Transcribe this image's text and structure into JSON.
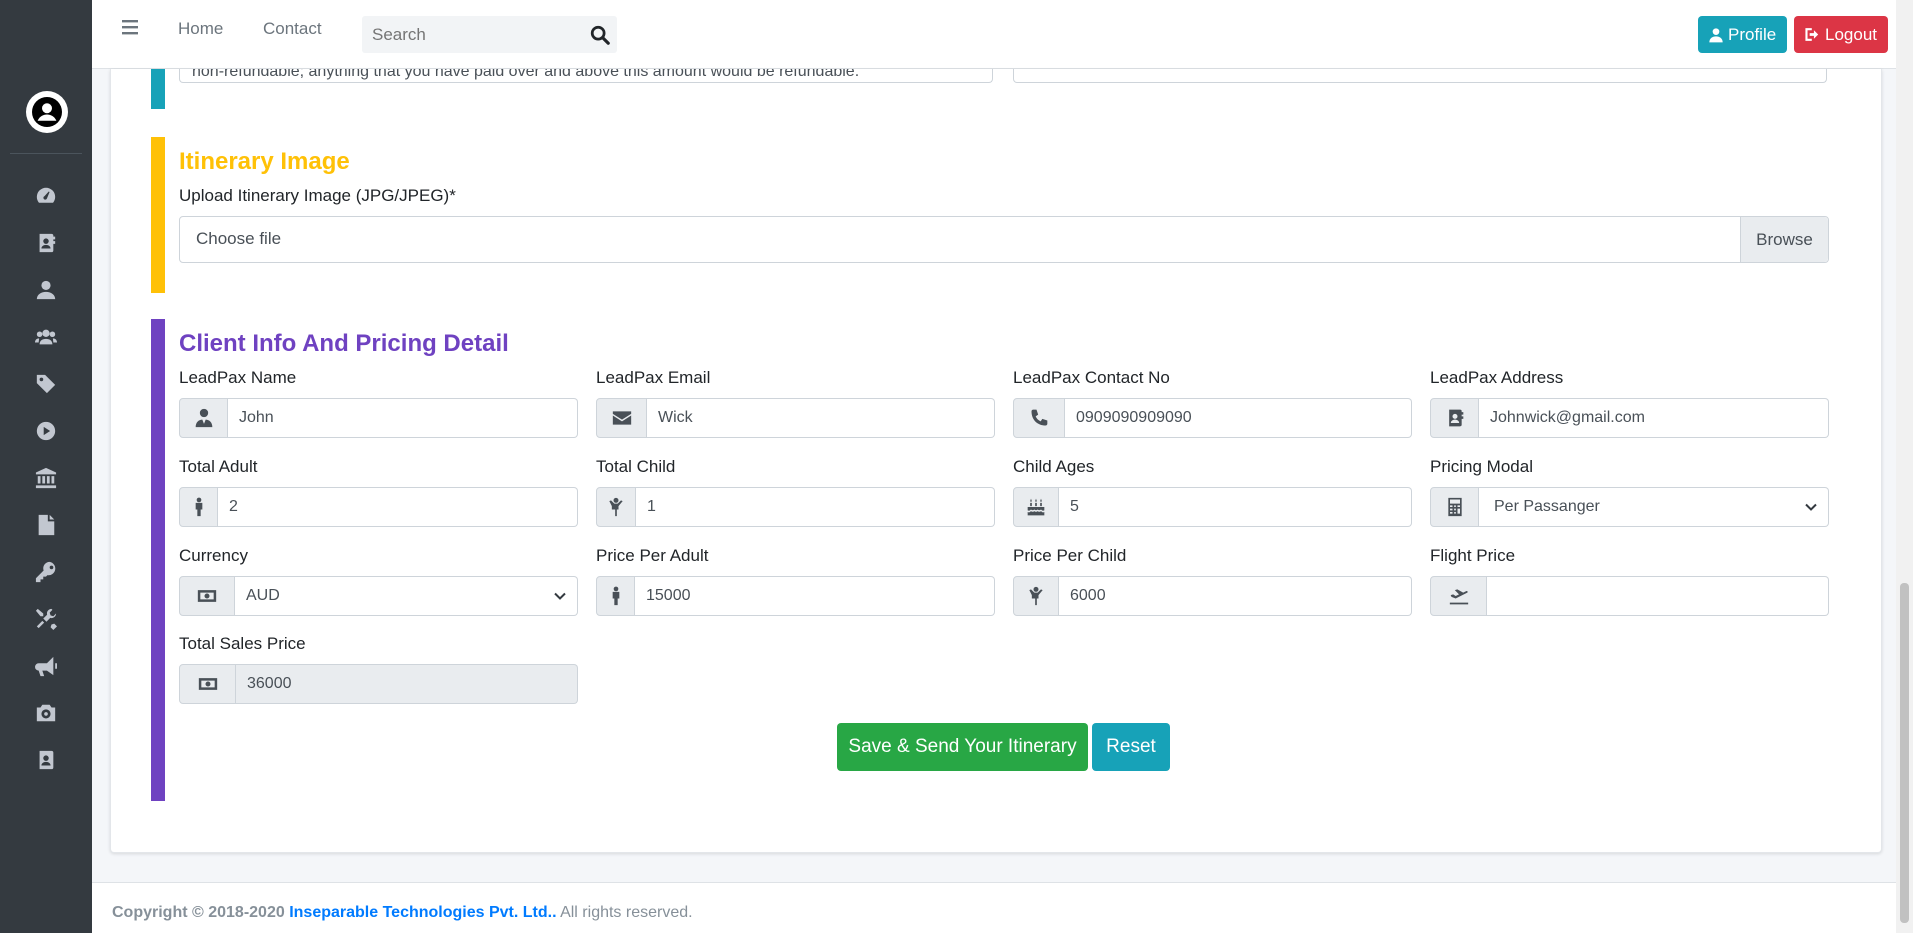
{
  "nav": {
    "home": "Home",
    "contact": "Contact",
    "search_placeholder": "Search",
    "profile": "Profile",
    "logout": "Logout"
  },
  "sidebar": {
    "icons": [
      "tachometer-icon",
      "address-book-icon",
      "user-icon",
      "users-icon",
      "tag-icon",
      "play-circle-icon",
      "bank-icon",
      "file-icon",
      "key-icon",
      "tools-icon",
      "bullhorn-icon",
      "camera-icon",
      "contact-card-icon"
    ]
  },
  "prev_section": {
    "partial_text": "non-refundable; anything that you have paid over and above this amount would be refundable."
  },
  "itinerary_image": {
    "title": "Itinerary Image",
    "upload_label": "Upload Itinerary Image (JPG/JPEG)*",
    "file_text": "Choose file",
    "browse": "Browse"
  },
  "client_info": {
    "title": "Client Info And Pricing Detail",
    "leadpax_name": {
      "label": "LeadPax Name",
      "value": "John"
    },
    "leadpax_email": {
      "label": "LeadPax Email",
      "value": "Wick"
    },
    "leadpax_contact": {
      "label": "LeadPax Contact No",
      "value": "0909090909090"
    },
    "leadpax_address": {
      "label": "LeadPax Address",
      "value": "Johnwick@gmail.com"
    },
    "total_adult": {
      "label": "Total Adult",
      "value": "2"
    },
    "total_child": {
      "label": "Total Child",
      "value": "1"
    },
    "child_ages": {
      "label": "Child Ages",
      "value": "5"
    },
    "pricing_modal": {
      "label": "Pricing Modal",
      "value": "Per Passanger"
    },
    "currency": {
      "label": "Currency",
      "value": "AUD"
    },
    "price_per_adult": {
      "label": "Price Per Adult",
      "value": "15000"
    },
    "price_per_child": {
      "label": "Price Per Child",
      "value": "6000"
    },
    "flight_price": {
      "label": "Flight Price",
      "value": ""
    },
    "total_sales_price": {
      "label": "Total Sales Price",
      "value": "36000"
    }
  },
  "actions": {
    "save": "Save & Send Your Itinerary",
    "reset": "Reset"
  },
  "footer": {
    "copyright": "Copyright © 2018-2020",
    "company": "Inseparable Technologies Pvt. Ltd..",
    "rights": "All rights reserved."
  },
  "colors": {
    "teal": "#17a2b8",
    "yellow": "#ffc107",
    "purple": "#6f42c1",
    "green": "#28a745",
    "red": "#dc3545",
    "sidebar": "#343a40"
  }
}
